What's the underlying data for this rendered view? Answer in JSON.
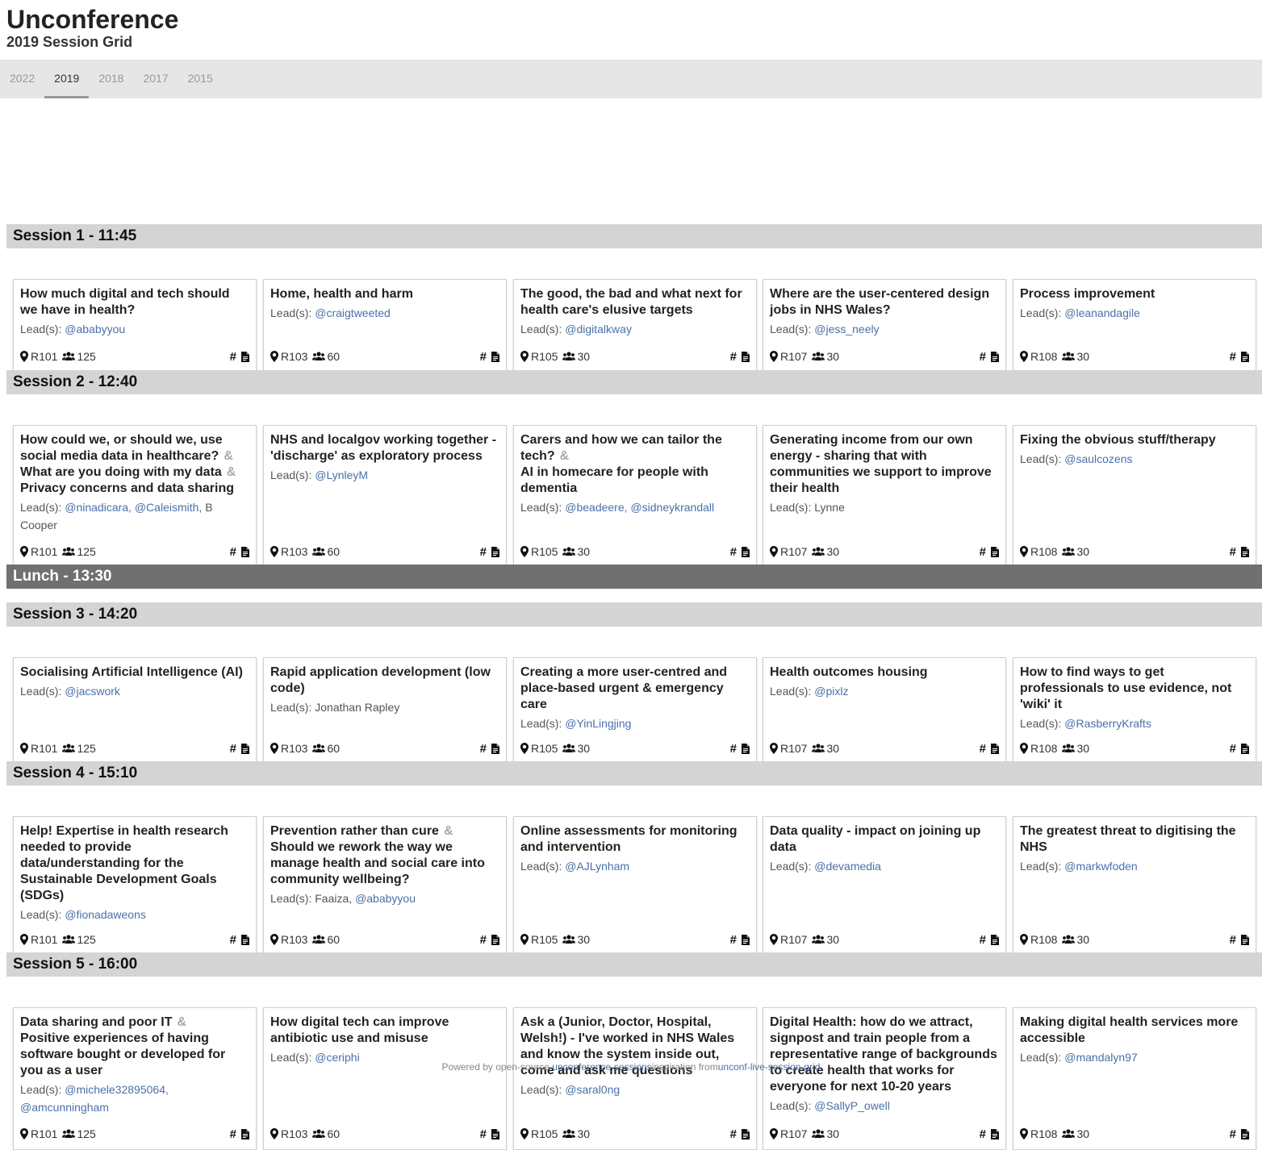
{
  "header": {
    "title": "Unconference",
    "subtitle": "2019 Session Grid"
  },
  "nav": {
    "tabs": [
      {
        "label": "2022",
        "active": false
      },
      {
        "label": "2019",
        "active": true
      },
      {
        "label": "2018",
        "active": false
      },
      {
        "label": "2017",
        "active": false
      },
      {
        "label": "2015",
        "active": false
      }
    ]
  },
  "labels": {
    "lead": "Lead(s):",
    "amp": "&",
    "hash": "#"
  },
  "rows": [
    {
      "title": "Session 1 - 11:45",
      "type": "session",
      "sessions": [
        {
          "titles": [
            "How much digital and tech should we have in health?"
          ],
          "leads": [
            {
              "text": "@ababyyou",
              "link": true
            }
          ],
          "room": "R101",
          "cap": "125"
        },
        {
          "titles": [
            "Home, health and harm"
          ],
          "leads": [
            {
              "text": "@craigtweeted",
              "link": true
            }
          ],
          "room": "R103",
          "cap": "60"
        },
        {
          "titles": [
            "The good, the bad and what next for health care's elusive targets"
          ],
          "leads": [
            {
              "text": "@digitalkway",
              "link": true
            }
          ],
          "room": "R105",
          "cap": "30"
        },
        {
          "titles": [
            "Where are the user-centered design jobs in NHS Wales?"
          ],
          "leads": [
            {
              "text": "@jess_neely",
              "link": true
            }
          ],
          "room": "R107",
          "cap": "30"
        },
        {
          "titles": [
            "Process improvement"
          ],
          "leads": [
            {
              "text": "@leanandagile",
              "link": true
            }
          ],
          "room": "R108",
          "cap": "30"
        }
      ]
    },
    {
      "title": "Session 2 - 12:40",
      "type": "session",
      "sessions": [
        {
          "titles": [
            "How could we, or should we, use social media data in healthcare?",
            "What are you doing with my data",
            "Privacy concerns and data sharing"
          ],
          "leads": [
            {
              "text": "@ninadicara,",
              "link": true
            },
            {
              "text": "@Caleismith,",
              "link": true
            },
            {
              "text": "B Cooper",
              "link": false
            }
          ],
          "room": "R101",
          "cap": "125"
        },
        {
          "titles": [
            "NHS and localgov working together - 'discharge' as exploratory process"
          ],
          "leads": [
            {
              "text": "@LynleyM",
              "link": true
            }
          ],
          "room": "R103",
          "cap": "60"
        },
        {
          "titles": [
            "Carers and how we can tailor the tech?",
            "AI in homecare for people with dementia"
          ],
          "leads": [
            {
              "text": "@beadeere,",
              "link": true
            },
            {
              "text": "@sidneykrandall",
              "link": true
            }
          ],
          "room": "R105",
          "cap": "30"
        },
        {
          "titles": [
            "Generating income from our own energy - sharing that with communities we support to improve their health"
          ],
          "leads": [
            {
              "text": "Lynne",
              "link": false
            }
          ],
          "room": "R107",
          "cap": "30"
        },
        {
          "titles": [
            "Fixing the obvious stuff/therapy"
          ],
          "leads": [
            {
              "text": "@saulcozens",
              "link": true
            }
          ],
          "room": "R108",
          "cap": "30"
        }
      ]
    },
    {
      "title": "Lunch - 13:30",
      "type": "lunch",
      "sessions": []
    },
    {
      "title": "Session 3 - 14:20",
      "type": "session",
      "sessions": [
        {
          "titles": [
            "Socialising Artificial Intelligence (AI)"
          ],
          "leads": [
            {
              "text": "@jacswork",
              "link": true
            }
          ],
          "room": "R101",
          "cap": "125"
        },
        {
          "titles": [
            "Rapid application development (low code)"
          ],
          "leads": [
            {
              "text": "Jonathan Rapley",
              "link": false
            }
          ],
          "room": "R103",
          "cap": "60"
        },
        {
          "titles": [
            "Creating a more user-centred and place-based urgent & emergency care"
          ],
          "leads": [
            {
              "text": "@YinLingjing",
              "link": true
            }
          ],
          "room": "R105",
          "cap": "30"
        },
        {
          "titles": [
            "Health outcomes housing"
          ],
          "leads": [
            {
              "text": "@pixlz",
              "link": true
            }
          ],
          "room": "R107",
          "cap": "30"
        },
        {
          "titles": [
            "How to find ways to get professionals to use evidence, not 'wiki' it"
          ],
          "leads": [
            {
              "text": "@RasberryKrafts",
              "link": true
            }
          ],
          "room": "R108",
          "cap": "30"
        }
      ]
    },
    {
      "title": "Session 4 - 15:10",
      "type": "session",
      "sessions": [
        {
          "titles": [
            "Help! Expertise in health research needed to provide data/understanding for the Sustainable Development Goals (SDGs)"
          ],
          "leads": [
            {
              "text": "@fionadaweons",
              "link": true
            }
          ],
          "room": "R101",
          "cap": "125"
        },
        {
          "titles": [
            "Prevention rather than cure",
            "Should we rework the way we manage health and social care into community wellbeing?"
          ],
          "leads": [
            {
              "text": "Faaiza,",
              "link": false
            },
            {
              "text": "@ababyyou",
              "link": true
            }
          ],
          "room": "R103",
          "cap": "60"
        },
        {
          "titles": [
            "Online assessments for monitoring and intervention"
          ],
          "leads": [
            {
              "text": "@AJLynham",
              "link": true
            }
          ],
          "room": "R105",
          "cap": "30"
        },
        {
          "titles": [
            "Data quality - impact on joining up data"
          ],
          "leads": [
            {
              "text": "@devamedia",
              "link": true
            }
          ],
          "room": "R107",
          "cap": "30"
        },
        {
          "titles": [
            "The greatest threat to digitising the NHS"
          ],
          "leads": [
            {
              "text": "@markwfoden",
              "link": true
            }
          ],
          "room": "R108",
          "cap": "30"
        }
      ]
    },
    {
      "title": "Session 5 - 16:00",
      "type": "session",
      "sessions": [
        {
          "titles": [
            "Data sharing and poor IT",
            "Positive experiences of having software bought or developed for you as a user"
          ],
          "leads": [
            {
              "text": "@michele32895064,",
              "link": true
            },
            {
              "text": "@amcunningham",
              "link": true
            }
          ],
          "room": "R101",
          "cap": "125"
        },
        {
          "titles": [
            "How digital tech can improve antibiotic use and misuse"
          ],
          "leads": [
            {
              "text": "@ceriphi",
              "link": true
            }
          ],
          "room": "R103",
          "cap": "60"
        },
        {
          "titles": [
            "Ask a (Junior, Doctor, Hospital, Welsh!) - I've worked in NHS Wales and know the system inside out, come and ask me questions"
          ],
          "leads": [
            {
              "text": "@saral0ng",
              "link": true
            }
          ],
          "room": "R105",
          "cap": "30"
        },
        {
          "titles": [
            "Digital Health: how do we attract, signpost and train people from a representative range of backgrounds to create health that works for everyone for next 10-20 years"
          ],
          "leads": [
            {
              "text": "@SallyP_owell",
              "link": true
            }
          ],
          "room": "R107",
          "cap": "30"
        },
        {
          "titles": [
            "Making digital health services more accessible"
          ],
          "leads": [
            {
              "text": "@mandalyn97",
              "link": true
            }
          ],
          "room": "R108",
          "cap": "30"
        }
      ]
    }
  ],
  "footer": {
    "prefix": "Powered by open-source ",
    "link1": "unconference-sessions",
    "middle": "inspiration from",
    "link2": "unconf-live-session-grid"
  }
}
